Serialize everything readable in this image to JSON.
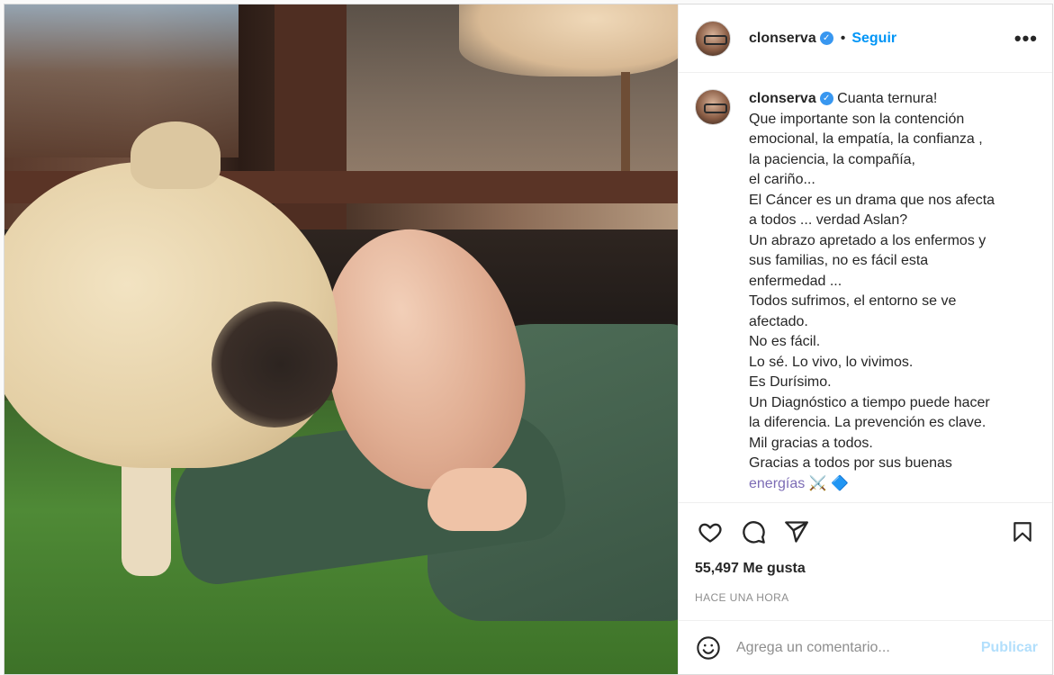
{
  "post": {
    "username": "clonserva",
    "follow_label": "Seguir",
    "separator": "•",
    "more_label": "•••",
    "verified_mark": "✓"
  },
  "caption": {
    "username": "clonserva",
    "lines": [
      "Cuanta ternura!",
      "Que importante son la contención",
      "emocional, la empatía, la confianza ,",
      " la paciencia, la compañía,",
      "el cariño...",
      "El Cáncer es un drama que nos afecta",
      "a todos ... verdad Aslan?",
      "Un abrazo apretado a los enfermos y",
      "sus familias, no es fácil esta",
      "enfermedad ...",
      "Todos sufrimos, el entorno se ve",
      "afectado.",
      "No es fácil.",
      "Lo sé. Lo vivo, lo vivimos.",
      "Es Durísimo.",
      "Un Diagnóstico a tiempo puede hacer",
      "la diferencia. La prevención es clave.",
      "Mil gracias a todos.",
      "Gracias a todos por sus buenas",
      "energías ⚔️ 🔷"
    ]
  },
  "actions": {
    "like_icon": "heart-icon",
    "comment_icon": "comment-icon",
    "share_icon": "share-icon",
    "save_icon": "bookmark-icon"
  },
  "likes": "55,497 Me gusta",
  "timestamp": "HACE UNA HORA",
  "comment": {
    "placeholder": "Agrega un comentario...",
    "value": "",
    "publish_label": "Publicar",
    "emoji_icon": "smiley-icon"
  },
  "colors": {
    "link": "#0095f6",
    "publish_disabled": "#b2dffc",
    "verified": "#3897f0",
    "muted": "#8e8e8e"
  }
}
